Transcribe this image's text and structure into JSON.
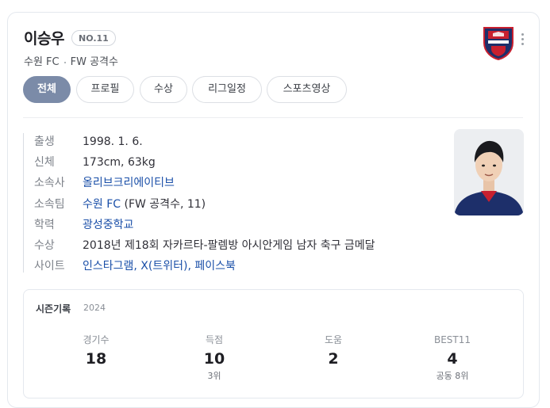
{
  "player": {
    "name": "이승우",
    "number": "NO.11",
    "team": "수원 FC",
    "position": "FW 공격수"
  },
  "tabs": [
    "전체",
    "프로필",
    "수상",
    "리그일정",
    "스포츠영상"
  ],
  "active_tab": "전체",
  "profile": [
    {
      "label": "출생",
      "parts": [
        {
          "text": "1998. 1. 6.",
          "link": false
        }
      ]
    },
    {
      "label": "신체",
      "parts": [
        {
          "text": "173cm, 63kg",
          "link": false
        }
      ]
    },
    {
      "label": "소속사",
      "parts": [
        {
          "text": "올리브크리에이티브",
          "link": true
        }
      ]
    },
    {
      "label": "소속팀",
      "parts": [
        {
          "text": "수원 FC",
          "link": true
        },
        {
          "text": " (FW 공격수, 11)",
          "link": false
        }
      ]
    },
    {
      "label": "학력",
      "parts": [
        {
          "text": "광성중학교",
          "link": true
        }
      ]
    },
    {
      "label": "수상",
      "parts": [
        {
          "text": "2018년 제18회 자카르타-팔렘방 아시안게임 남자 축구 금메달",
          "link": false
        }
      ]
    },
    {
      "label": "사이트",
      "parts": [
        {
          "text": "인스타그램, X(트위터), 페이스북",
          "link": true
        }
      ]
    }
  ],
  "season": {
    "title": "시즌기록",
    "year": "2024",
    "stats": [
      {
        "label": "경기수",
        "value": "18",
        "sub": ""
      },
      {
        "label": "득점",
        "value": "10",
        "sub": "3위"
      },
      {
        "label": "도움",
        "value": "2",
        "sub": ""
      },
      {
        "label": "BEST11",
        "value": "4",
        "sub": "공동 8위"
      }
    ]
  },
  "colors": {
    "accent_tab": "#7b8ba8",
    "link": "#1a4fa8",
    "emblem_red": "#c8202f",
    "emblem_navy": "#1d2f6a"
  },
  "icons": {
    "emblem": "suwon-fc-emblem",
    "more": "more-vertical-icon"
  }
}
